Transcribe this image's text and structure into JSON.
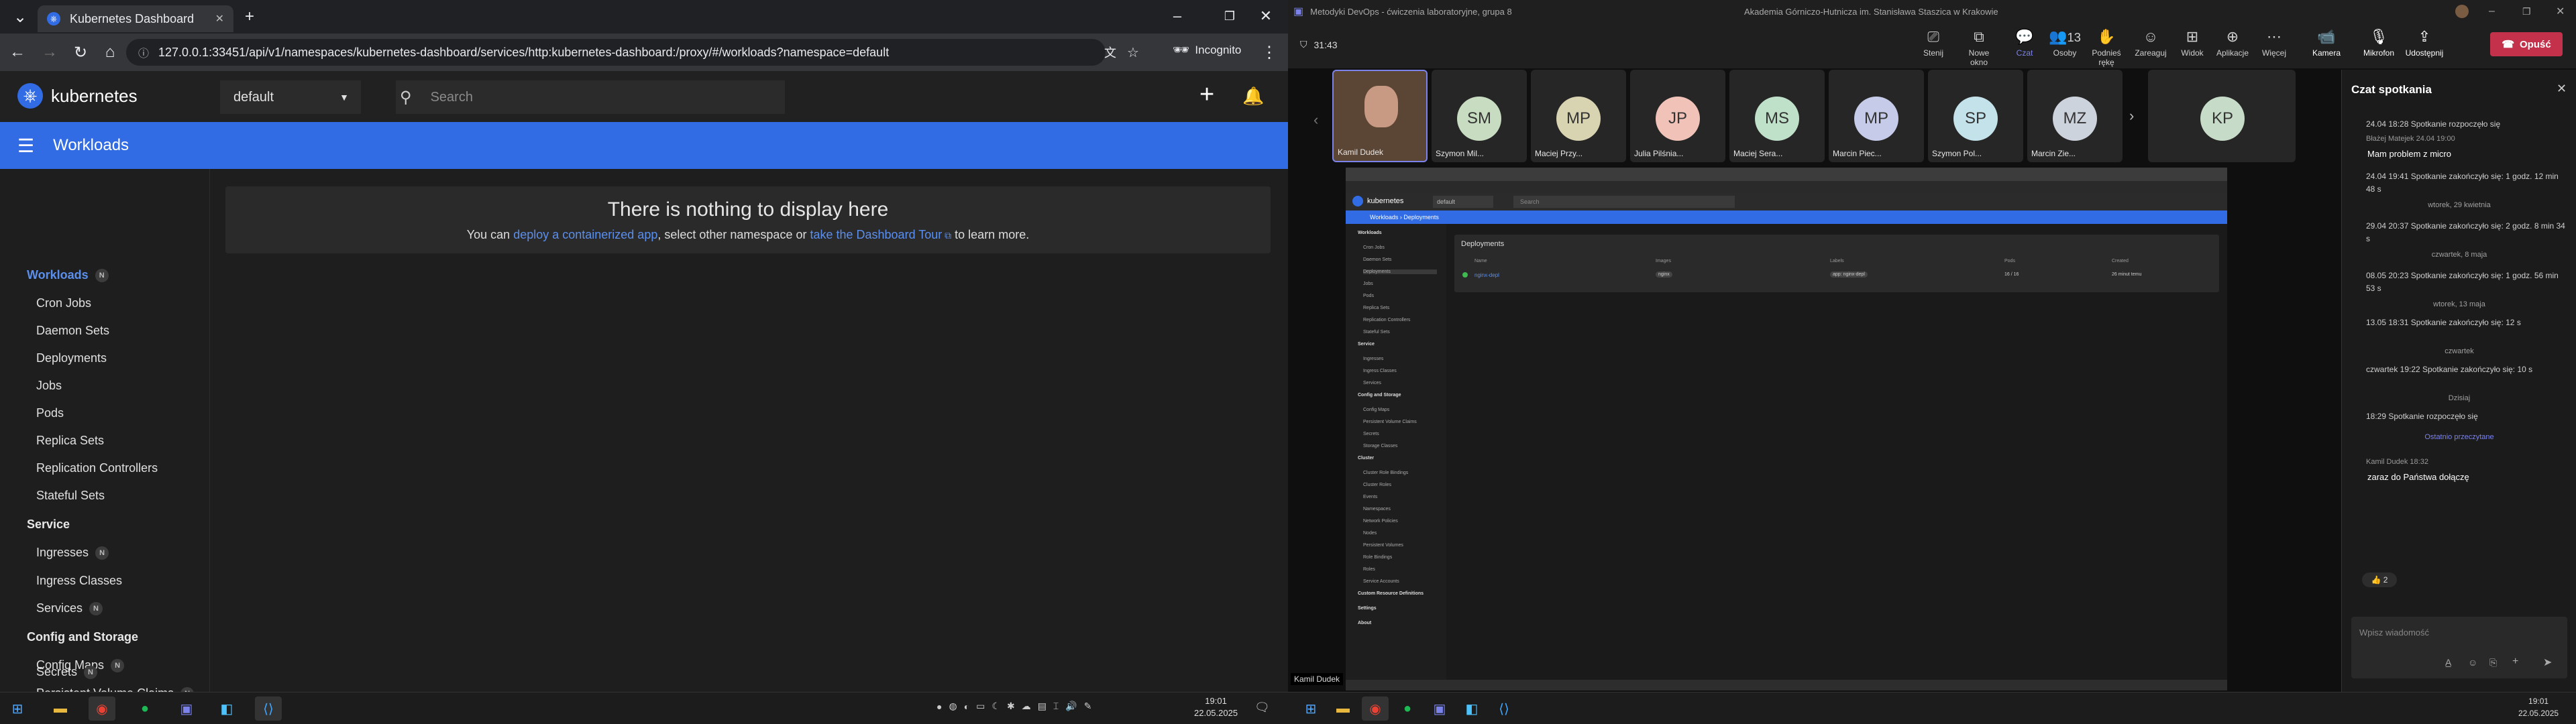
{
  "left": {
    "browser": {
      "tab_title": "Kubernetes Dashboard",
      "new_tab": "+",
      "url": "127.0.0.1:33451/api/v1/namespaces/kubernetes-dashboard/services/http:kubernetes-dashboard:/proxy/#/workloads?namespace=default",
      "incognito_label": "Incognito",
      "window_controls": [
        "–",
        "❐",
        "✕"
      ]
    },
    "dashboard": {
      "brand": "kubernetes",
      "namespace": "default",
      "search_placeholder": "Search",
      "add_symbol": "+",
      "page_title": "Workloads",
      "empty_title": "There is nothing to display here",
      "empty_text_1": "You can ",
      "empty_link_1": "deploy a containerized app",
      "empty_text_2": ", select other namespace or ",
      "empty_link_2": "take the Dashboard Tour",
      "empty_text_3": " to learn more.",
      "badge_text": "N",
      "sidebar": {
        "workloads": "Workloads",
        "cron_jobs": "Cron Jobs",
        "daemon_sets": "Daemon Sets",
        "deployments": "Deployments",
        "jobs": "Jobs",
        "pods": "Pods",
        "replica_sets": "Replica Sets",
        "replication_controllers": "Replication Controllers",
        "stateful_sets": "Stateful Sets",
        "service": "Service",
        "ingresses": "Ingresses",
        "ingress_classes": "Ingress Classes",
        "services": "Services",
        "config_storage": "Config and Storage",
        "config_maps": "Config Maps",
        "pvc": "Persistent Volume Claims",
        "secrets": "Secrets"
      }
    },
    "taskbar": {
      "time": "19:01",
      "date": "22.05.2025"
    }
  },
  "right": {
    "window_title": "Metodyki DevOps - ćwiczenia laboratoryjne, grupa 8",
    "org": "Akademia Górniczo-Hutnicza im. Stanisława Staszica w Krakowie",
    "timer": "31:43",
    "toolbar": {
      "stage": "Stenij",
      "new_window": "Nowe okno",
      "chat": "Czat",
      "people": "Osoby",
      "people_count": "13",
      "raise": "Podnieś rękę",
      "react": "Zareaguj",
      "view": "Widok",
      "apps": "Aplikacje",
      "more": "Więcej",
      "camera": "Kamera",
      "mic": "Mikrofon",
      "share": "Udostępnij",
      "leave": "Opuść"
    },
    "participants": [
      {
        "initials": "",
        "name": "Kamil Dudek"
      },
      {
        "initials": "SM",
        "name": "Szymon Mil..."
      },
      {
        "initials": "MP",
        "name": "Maciej Przy..."
      },
      {
        "initials": "JP",
        "name": "Julia Pilśnia..."
      },
      {
        "initials": "MS",
        "name": "Maciej Sera..."
      },
      {
        "initials": "MP",
        "name": "Marcin Piec..."
      },
      {
        "initials": "SP",
        "name": "Szymon Pol..."
      },
      {
        "initials": "MZ",
        "name": "Marcin Zie..."
      },
      {
        "initials": "KP",
        "name": ""
      }
    ],
    "shared_screen": {
      "brand": "kubernetes",
      "namespace": "default",
      "search": "Search",
      "breadcrumb_root": "Workloads",
      "breadcrumb_current": "Deployments",
      "card_title": "Deployments",
      "columns": [
        "Name",
        "Images",
        "Labels",
        "Pods",
        "Created"
      ],
      "row": {
        "name": "nginx-depl",
        "image": "nginx",
        "label": "app: nginx-depl",
        "pods": "16 / 16",
        "created": "26 minut temu"
      },
      "nav": [
        {
          "t": "Workloads",
          "h": true
        },
        {
          "t": "Cron Jobs"
        },
        {
          "t": "Daemon Sets"
        },
        {
          "t": "Deployments",
          "sel": true
        },
        {
          "t": "Jobs"
        },
        {
          "t": "Pods"
        },
        {
          "t": "Replica Sets"
        },
        {
          "t": "Replication Controllers"
        },
        {
          "t": "Stateful Sets"
        },
        {
          "t": "Service",
          "h": true
        },
        {
          "t": "Ingresses"
        },
        {
          "t": "Ingress Classes"
        },
        {
          "t": "Services"
        },
        {
          "t": "Config and Storage",
          "h": true
        },
        {
          "t": "Config Maps"
        },
        {
          "t": "Persistent Volume Claims"
        },
        {
          "t": "Secrets"
        },
        {
          "t": "Storage Classes"
        },
        {
          "t": "Cluster",
          "h": true
        },
        {
          "t": "Cluster Role Bindings"
        },
        {
          "t": "Cluster Roles"
        },
        {
          "t": "Events"
        },
        {
          "t": "Namespaces"
        },
        {
          "t": "Network Policies"
        },
        {
          "t": "Nodes"
        },
        {
          "t": "Persistent Volumes"
        },
        {
          "t": "Role Bindings"
        },
        {
          "t": "Roles"
        },
        {
          "t": "Service Accounts"
        },
        {
          "t": "Custom Resource Definitions",
          "h": true
        },
        {
          "t": "Settings",
          "h": true
        },
        {
          "t": "About",
          "h": true
        }
      ],
      "speaker_label": "Kamil Dudek"
    },
    "chat": {
      "title": "Czat spotkania",
      "lines": [
        {
          "kind": "event",
          "text": "24.04 18:28   Spotkanie rozpoczęło się"
        },
        {
          "kind": "meta",
          "text": "Błażej Matejek  24.04 19:00"
        },
        {
          "kind": "msg",
          "text": "Mam problem z micro"
        },
        {
          "kind": "event",
          "text": "24.04 19:41   Spotkanie zakończyło się: 1 godz. 12 min 48 s"
        },
        {
          "kind": "center",
          "text": "wtorek, 29 kwietnia"
        },
        {
          "kind": "event",
          "text": "29.04 20:37   Spotkanie zakończyło się: 2 godz. 8 min 34 s"
        },
        {
          "kind": "center",
          "text": "czwartek, 8 maja"
        },
        {
          "kind": "event",
          "text": "08.05 20:23   Spotkanie zakończyło się: 1 godz. 56 min 53 s"
        },
        {
          "kind": "center",
          "text": "wtorek, 13 maja"
        },
        {
          "kind": "event",
          "text": "13.05 18:31   Spotkanie zakończyło się: 12 s"
        },
        {
          "kind": "center",
          "text": "czwartek"
        },
        {
          "kind": "event",
          "text": "czwartek 19:22   Spotkanie zakończyło się: 10 s"
        },
        {
          "kind": "center",
          "text": "Dzisiaj"
        },
        {
          "kind": "event",
          "text": "18:29   Spotkanie rozpoczęło się"
        },
        {
          "kind": "link",
          "text": "Ostatnio przeczytane"
        },
        {
          "kind": "meta",
          "text": "Kamil Dudek  18:32"
        },
        {
          "kind": "msg",
          "text": "zaraz do Państwa dołączę"
        }
      ],
      "reaction": "👍 2",
      "input_placeholder": "Wpisz wiadomość"
    },
    "taskbar": {
      "time": "19:01",
      "date": "22.05.2025"
    }
  }
}
